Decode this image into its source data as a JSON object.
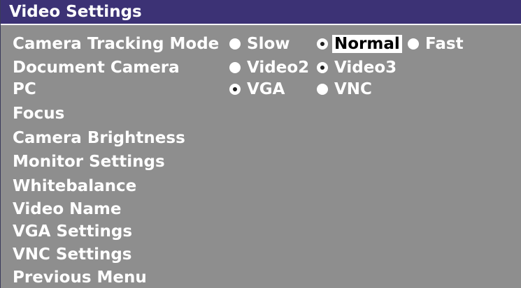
{
  "window": {
    "title": "Video Settings"
  },
  "menu": {
    "camera_tracking_mode": "Camera Tracking Mode",
    "document_camera": "Document Camera",
    "pc": "PC",
    "focus": "Focus",
    "camera_brightness": "Camera Brightness",
    "monitor_settings": "Monitor Settings",
    "whitebalance": "Whitebalance",
    "video_name": "Video Name",
    "vga_settings": "VGA Settings",
    "vnc_settings": "VNC Settings",
    "previous_menu": "Previous Menu"
  },
  "camera_tracking_options": {
    "slow": "Slow",
    "normal": "Normal",
    "fast": "Fast",
    "selected": "Normal"
  },
  "document_camera_options": {
    "video2": "Video2",
    "video3": "Video3",
    "selected": "Video3"
  },
  "pc_options": {
    "vga": "VGA",
    "vnc": "VNC",
    "selected": "VGA"
  },
  "colors": {
    "background": "#8e8e8e",
    "titlebar": "#3c3275",
    "text": "#ffffff",
    "highlight_bg": "#ffffff",
    "highlight_text": "#000000"
  }
}
